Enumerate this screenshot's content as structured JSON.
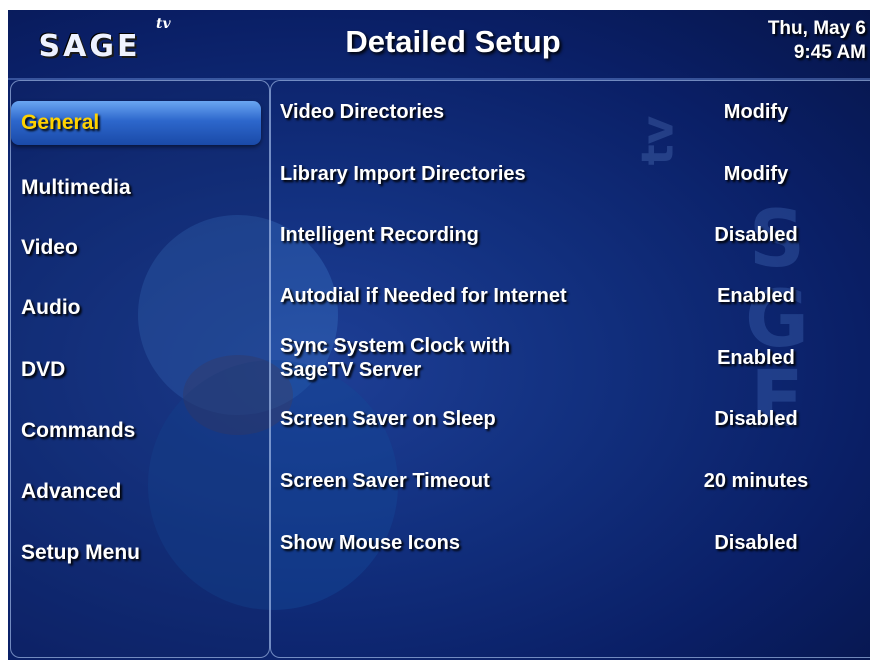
{
  "header": {
    "logo": "SAGE",
    "logo_tv": "tv",
    "title": "Detailed Setup",
    "date": "Thu, May 6",
    "time": "9:45 AM"
  },
  "menu": [
    {
      "label": "General",
      "selected": true
    },
    {
      "label": "Multimedia"
    },
    {
      "label": "Video"
    },
    {
      "label": "Audio"
    },
    {
      "label": "DVD"
    },
    {
      "label": "Commands"
    },
    {
      "label": "Advanced"
    },
    {
      "label": "Setup Menu"
    }
  ],
  "settings": [
    {
      "label": "Video Directories",
      "value": "Modify"
    },
    {
      "label": "Library Import Directories",
      "value": "Modify"
    },
    {
      "label": "Intelligent Recording",
      "value": "Disabled"
    },
    {
      "label": "Autodial if Needed for Internet",
      "value": "Enabled"
    },
    {
      "label": "Sync System Clock with SageTV Server",
      "value": "Enabled"
    },
    {
      "label": "Screen Saver on Sleep",
      "value": "Disabled"
    },
    {
      "label": "Screen Saver Timeout",
      "value": "20 minutes"
    },
    {
      "label": "Show Mouse Icons",
      "value": "Disabled"
    }
  ],
  "colors": {
    "background": "#0a1f66",
    "selected_text": "#ffd200",
    "text": "#ffffff"
  }
}
